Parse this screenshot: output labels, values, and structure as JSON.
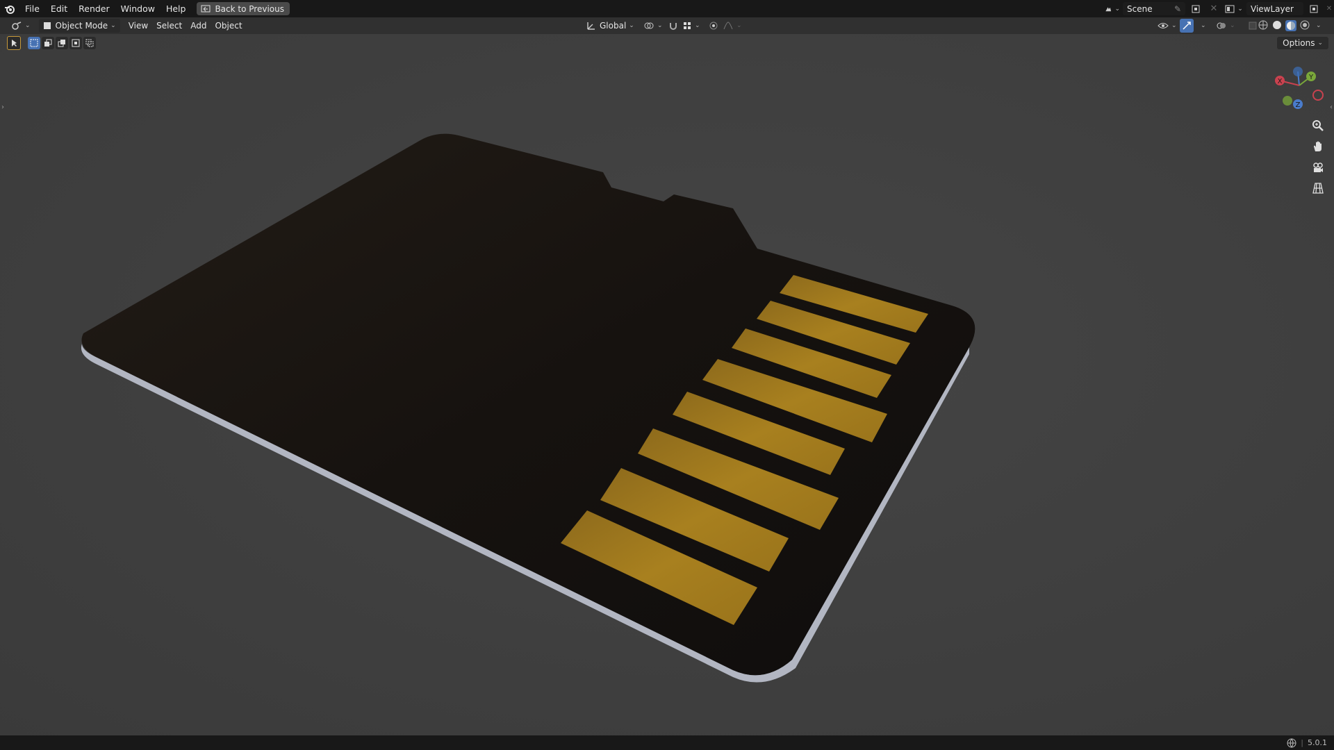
{
  "menu": {
    "items": [
      "File",
      "Edit",
      "Render",
      "Window",
      "Help"
    ],
    "back_button": "Back to Previous"
  },
  "top_right": {
    "scene": "Scene",
    "view_layer": "ViewLayer"
  },
  "header": {
    "mode": "Object Mode",
    "view": "View",
    "select": "Select",
    "add": "Add",
    "object": "Object",
    "transform_orientation": "Global"
  },
  "viewport": {
    "options_label": "Options",
    "gizmo": {
      "x": "X",
      "y": "Y",
      "z": "Z"
    }
  },
  "status": {
    "version": "5.0.1"
  },
  "colors": {
    "card": "#151210",
    "contact": "#a07a1f",
    "background": "#3f3f3f"
  }
}
